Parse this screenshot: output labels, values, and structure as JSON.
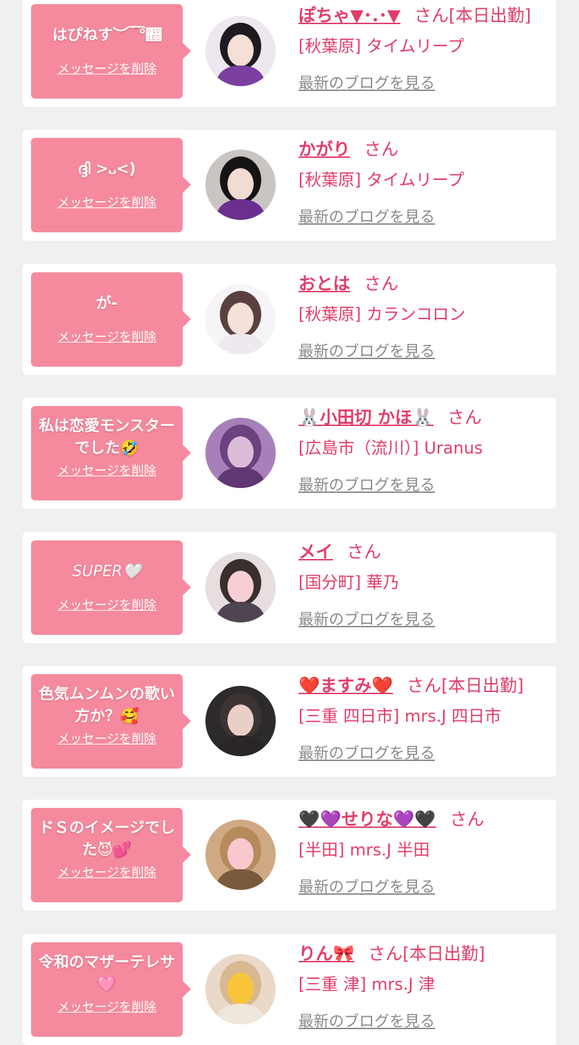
{
  "colors": {
    "background": "#f0f0f0",
    "card": "#ffffff",
    "bubble": "#f58a9e",
    "accent": "#e23d6a",
    "muted": "#8a8a8a"
  },
  "entries": [
    {
      "message": "はぴねす︶ ͡ ͡°𝇭",
      "delete_label": "メッセージを削除",
      "name": "ぽちゃ▼･.･▼",
      "suffix": "さん[本日出勤]",
      "shop": "[秋葉原] タイムリープ",
      "blog_label": "最新のブログを見る",
      "avatar": {
        "bg": "#ede7ef",
        "hair": "#1f1a20",
        "face": "#f5dfd6",
        "outfit": "#7b3fa0"
      }
    },
    {
      "message": "ദ്ദി >᎑<)",
      "delete_label": "メッセージを削除",
      "name": "かがり",
      "suffix": "さん",
      "shop": "[秋葉原] タイムリープ",
      "blog_label": "最新のブログを見る",
      "avatar": {
        "bg": "#c9c5c2",
        "hair": "#161316",
        "face": "#f1dbd2",
        "outfit": "#6a2f8f"
      }
    },
    {
      "message": "が-",
      "delete_label": "メッセージを削除",
      "name": "おとは",
      "suffix": "さん",
      "shop": "[秋葉原] カランコロン",
      "blog_label": "最新のブログを見る",
      "avatar": {
        "bg": "#f6f4f6",
        "hair": "#5a4040",
        "face": "#f4e2da",
        "outfit": "#ede9ee"
      }
    },
    {
      "message": "私は恋愛モンスターでした🤣",
      "delete_label": "メッセージを削除",
      "name": "🐰小田切 かほ🐰",
      "suffix": "さん",
      "shop": "[広島市（流川）] Uranus",
      "blog_label": "最新のブログを見る",
      "avatar": {
        "bg": "#a880b9",
        "hair": "#6c4180",
        "face": "#dcbdd8",
        "outfit": "#5f3773"
      }
    },
    {
      "message": "SUPER🤍",
      "italic": true,
      "delete_label": "メッセージを削除",
      "name": "メイ",
      "suffix": "さん",
      "shop": "[国分町] 華乃",
      "blog_label": "最新のブログを見る",
      "avatar": {
        "bg": "#e6dedf",
        "hair": "#3a2e2e",
        "face": "#f6d0d4",
        "outfit": "#4f4552"
      }
    },
    {
      "message": "色気ムンムンの歌い方か？🥰",
      "delete_label": "メッセージを削除",
      "name": "❤️ますみ❤️",
      "suffix": "さん[本日出勤]",
      "shop": "[三重 四日市] mrs.J 四日市",
      "blog_label": "最新のブログを見る",
      "avatar": {
        "bg": "#2c2a2c",
        "hair": "#3b3432",
        "face": "#e9cfc5",
        "outfit": "#2a2529"
      }
    },
    {
      "message": "ドＳのイメージでした😈💕",
      "delete_label": "メッセージを削除",
      "name": "🖤💜せりな💜🖤",
      "suffix": "さん",
      "shop": "[半田] mrs.J 半田",
      "blog_label": "最新のブログを見る",
      "avatar": {
        "bg": "#cfa983",
        "hair": "#b78a5e",
        "face": "#f7c9cf",
        "outfit": "#7a5a3c"
      }
    },
    {
      "message": "令和のマザーテレサ🩷",
      "delete_label": "メッセージを削除",
      "name": "りん🎀",
      "suffix": "さん[本日出勤]",
      "shop": "[三重 津] mrs.J 津",
      "blog_label": "最新のブログを見る",
      "avatar": {
        "bg": "#ead9c9",
        "hair": "#d7b890",
        "face": "#f8c53a",
        "outfit": "#efe6dc"
      }
    }
  ]
}
